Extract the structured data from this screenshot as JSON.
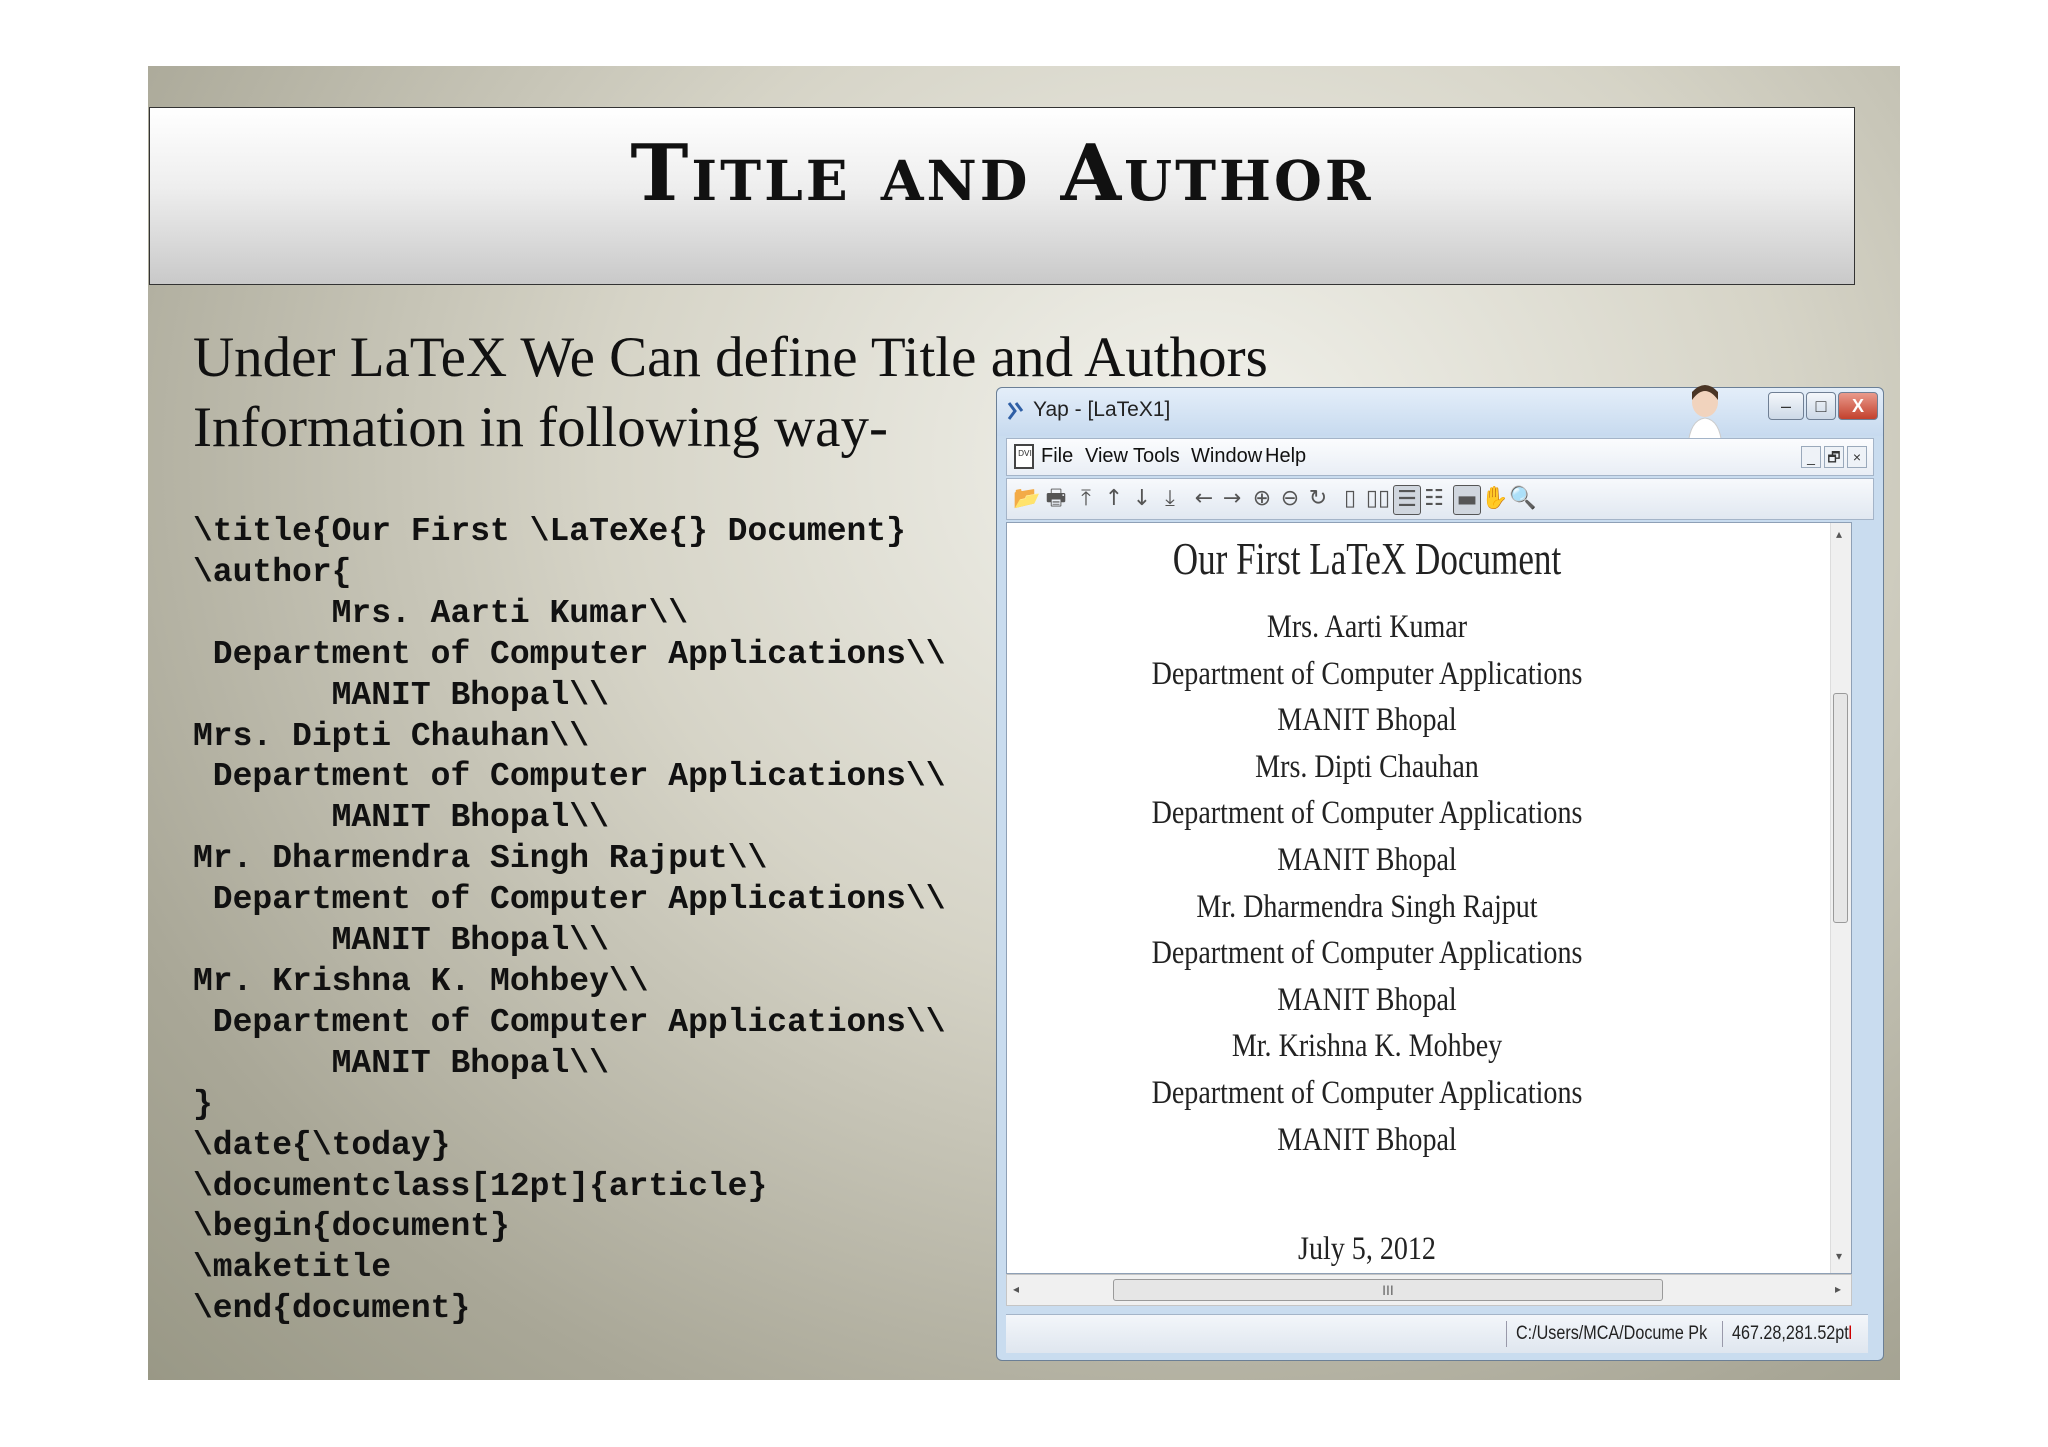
{
  "slide": {
    "title": "Title and Author",
    "intro_line1": "Under LaTeX We Can define Title and Authors",
    "intro_line2": "Information in following way-",
    "code_lines": [
      "\\title{Our First \\LaTeXe{} Document}",
      "\\author{",
      "       Mrs. Aarti Kumar\\\\",
      " Department of Computer Applications\\\\",
      "       MANIT Bhopal\\\\",
      "Mrs. Dipti Chauhan\\\\",
      " Department of Computer Applications\\\\",
      "       MANIT Bhopal\\\\",
      "Mr. Dharmendra Singh Rajput\\\\",
      " Department of Computer Applications\\\\",
      "       MANIT Bhopal\\\\",
      "Mr. Krishna K. Mohbey\\\\",
      " Department of Computer Applications\\\\",
      "       MANIT Bhopal\\\\",
      "}",
      "\\date{\\today}",
      "\\documentclass[12pt]{article}",
      "\\begin{document}",
      "\\maketitle",
      "\\end{document}"
    ]
  },
  "window": {
    "title": "Yap - [LaTeX1]",
    "buttons": {
      "minimize": "–",
      "maximize": "□",
      "close": "X"
    },
    "menu": [
      "File",
      "View",
      "Tools",
      "Window",
      "Help"
    ],
    "mdi_buttons": [
      "_",
      "🗗",
      "×"
    ],
    "toolbar_icons": [
      "open-icon",
      "print-icon",
      "first-page-icon",
      "page-up-icon",
      "page-down-icon",
      "last-page-icon",
      "back-icon",
      "forward-icon",
      "zoom-in-icon",
      "zoom-out-icon",
      "refresh-icon",
      "single-page-icon",
      "double-page-icon",
      "continuous-icon",
      "continuous-double-icon",
      "ruler-icon",
      "hand-icon",
      "magnifier-icon"
    ],
    "toolbar_glyphs": [
      "📂",
      "🖶",
      "⤒",
      "↑",
      "↓",
      "⤓",
      "←",
      "→",
      "⊕",
      "⊖",
      "↻",
      "▯",
      "▯▯",
      "☰",
      "☷",
      "▬",
      "✋",
      "🔍"
    ],
    "document": {
      "title": "Our First LaTeX Document",
      "lines": [
        "Mrs. Aarti Kumar",
        "Department of Computer Applications",
        "MANIT Bhopal",
        "Mrs. Dipti Chauhan",
        "Department of Computer Applications",
        "MANIT Bhopal",
        "Mr. Dharmendra Singh Rajput",
        "Department of Computer Applications",
        "MANIT Bhopal",
        "Mr. Krishna K. Mohbey",
        "Department of Computer Applications",
        "MANIT Bhopal"
      ],
      "date": "July 5, 2012"
    },
    "scrollbar_grip": "III",
    "status": {
      "path": "C:/Users/MCA/Docume Pk",
      "coords": "467.28,281.52pt",
      "indicator": "I"
    }
  }
}
